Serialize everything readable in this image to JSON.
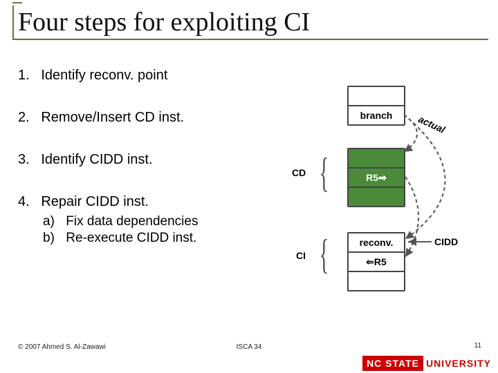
{
  "title": "Four steps for exploiting CI",
  "steps": [
    {
      "num": "1.",
      "text": "Identify reconv. point"
    },
    {
      "num": "2.",
      "text": "Remove/Insert CD inst."
    },
    {
      "num": "3.",
      "text": "Identify CIDD inst."
    },
    {
      "num": "4.",
      "text": "Repair CIDD inst."
    }
  ],
  "sub": [
    {
      "key": "a)",
      "text": "Fix data dependencies"
    },
    {
      "key": "b)",
      "text": "Re-execute CIDD inst."
    }
  ],
  "footer": {
    "copyright": "© 2007 Ahmed S. Al-Zawawi",
    "conference": "ISCA 34",
    "page": "11",
    "brand1": "NC STATE",
    "brand2": "UNIVERSITY"
  },
  "diagram": {
    "branch": "branch",
    "actual": "actual",
    "cd": "CD",
    "ci": "CI",
    "r5out": "R5",
    "reconv": "reconv.",
    "r5in": "R5",
    "cidd": "CIDD",
    "arrow": "⇐",
    "arrow2": "➡"
  }
}
